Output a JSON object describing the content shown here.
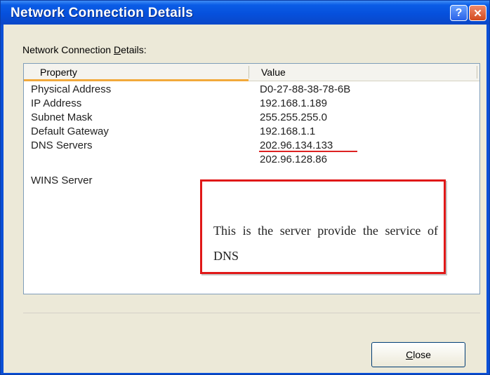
{
  "window": {
    "title": "Network Connection Details"
  },
  "titlebar_buttons": {
    "help": "?",
    "close": "✕"
  },
  "section_label": {
    "before": "Network Connection ",
    "accel": "D",
    "after": "etails:"
  },
  "list": {
    "columns": [
      "Property",
      "Value"
    ],
    "rows": [
      {
        "property": "Physical Address",
        "value": "D0-27-88-38-78-6B"
      },
      {
        "property": "IP Address",
        "value": "192.168.1.189"
      },
      {
        "property": "Subnet Mask",
        "value": "255.255.255.0"
      },
      {
        "property": "Default Gateway",
        "value": "192.168.1.1"
      },
      {
        "property": "DNS Servers",
        "value": "202.96.134.133"
      },
      {
        "property": "",
        "value": "202.96.128.86"
      },
      {
        "property": "WINS Server",
        "value": ""
      }
    ]
  },
  "annotation": {
    "text": "This is the server provide the service of DNS",
    "color": "#e01818"
  },
  "close_button": {
    "accel": "C",
    "rest": "lose"
  }
}
